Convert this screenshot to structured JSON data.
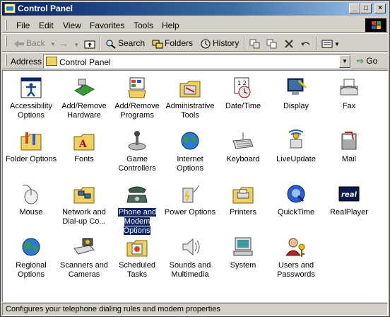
{
  "window": {
    "title": "Control Panel",
    "controls": {
      "minimize": "_",
      "maximize": "□",
      "close": "×"
    }
  },
  "menu": [
    "File",
    "Edit",
    "View",
    "Favorites",
    "Tools",
    "Help"
  ],
  "toolbar": {
    "back": "Back",
    "forward": "→",
    "search": "Search",
    "folders": "Folders",
    "history": "History"
  },
  "address": {
    "label": "Address",
    "value": "Control Panel",
    "go": "Go"
  },
  "items": [
    {
      "label": "Accessibility Options",
      "icon": "accessibility-icon"
    },
    {
      "label": "Add/Remove Hardware",
      "icon": "hardware-icon"
    },
    {
      "label": "Add/Remove Programs",
      "icon": "programs-icon"
    },
    {
      "label": "Administrative Tools",
      "icon": "admin-tools-icon"
    },
    {
      "label": "Date/Time",
      "icon": "calendar-clock-icon"
    },
    {
      "label": "Display",
      "icon": "display-icon"
    },
    {
      "label": "Fax",
      "icon": "fax-icon"
    },
    {
      "label": "Folder Options",
      "icon": "folder-options-icon"
    },
    {
      "label": "Fonts",
      "icon": "fonts-folder-icon"
    },
    {
      "label": "Game Controllers",
      "icon": "joystick-icon"
    },
    {
      "label": "Internet Options",
      "icon": "globe-icon"
    },
    {
      "label": "Keyboard",
      "icon": "keyboard-icon"
    },
    {
      "label": "LiveUpdate",
      "icon": "liveupdate-icon"
    },
    {
      "label": "Mail",
      "icon": "mail-icon"
    },
    {
      "label": "Mouse",
      "icon": "mouse-icon"
    },
    {
      "label": "Network and Dial-up Co...",
      "icon": "network-folder-icon"
    },
    {
      "label": "Phone and Modem Options",
      "icon": "phone-icon",
      "selected": true
    },
    {
      "label": "Power Options",
      "icon": "power-icon"
    },
    {
      "label": "Printers",
      "icon": "printers-folder-icon"
    },
    {
      "label": "QuickTime",
      "icon": "quicktime-icon"
    },
    {
      "label": "RealPlayer",
      "icon": "realplayer-icon"
    },
    {
      "label": "Regional Options",
      "icon": "regional-globe-icon"
    },
    {
      "label": "Scanners and Cameras",
      "icon": "scanner-icon"
    },
    {
      "label": "Scheduled Tasks",
      "icon": "scheduled-tasks-icon"
    },
    {
      "label": "Sounds and Multimedia",
      "icon": "speaker-icon"
    },
    {
      "label": "System",
      "icon": "computer-icon"
    },
    {
      "label": "Users and Passwords",
      "icon": "users-key-icon"
    }
  ],
  "status": "Configures your telephone dialing rules and modem properties",
  "colors": {
    "titlebar": "#0a246a",
    "selection": "#0a246a",
    "face": "#d4d0c8"
  }
}
